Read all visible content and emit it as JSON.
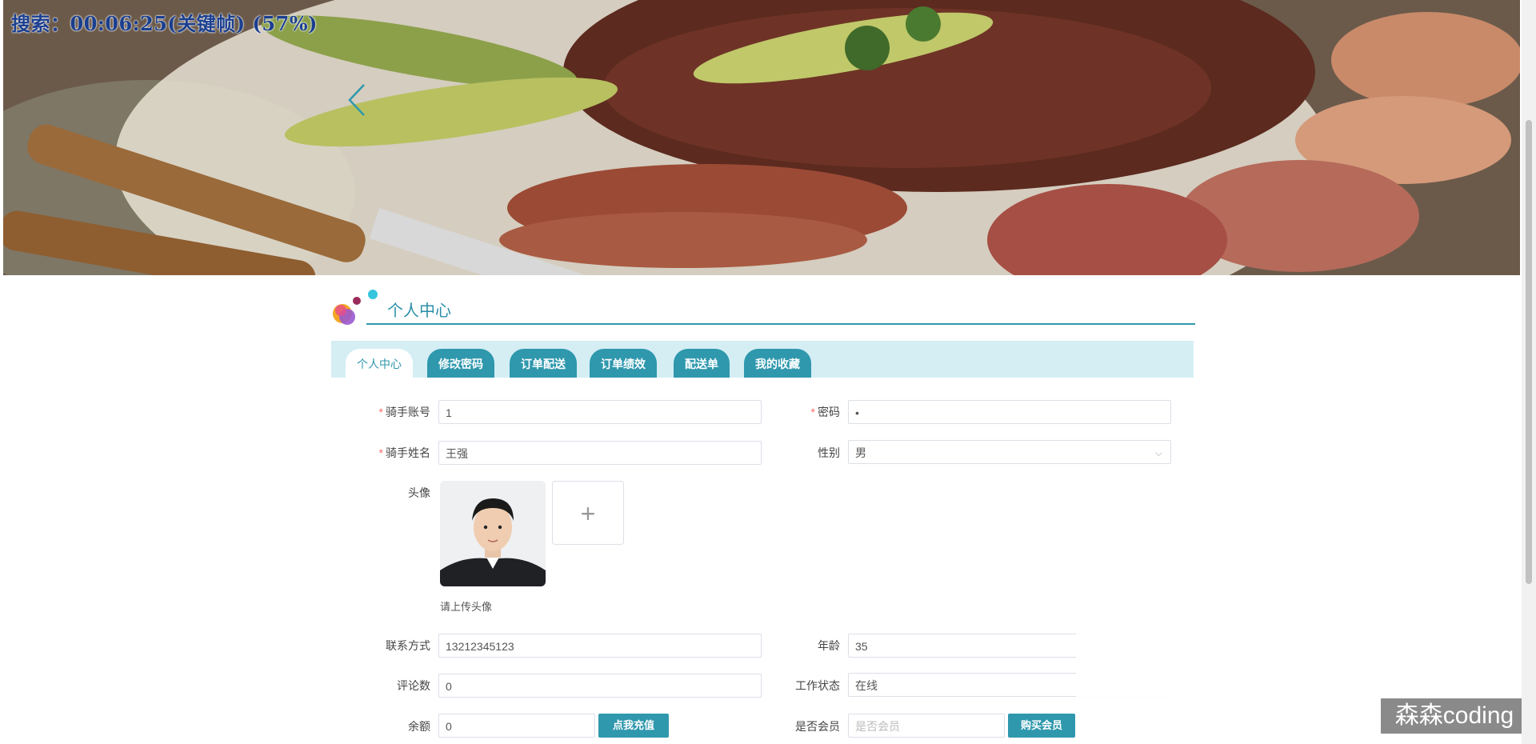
{
  "overlay": {
    "search_status": "搜索：00:06:25(关键帧) (57%)"
  },
  "header": {
    "title": "个人中心"
  },
  "tabs": [
    {
      "label": "个人中心",
      "active": true
    },
    {
      "label": "修改密码",
      "active": false
    },
    {
      "label": "订单配送",
      "active": false
    },
    {
      "label": "订单绩效",
      "active": false
    },
    {
      "label": "配送单",
      "active": false
    },
    {
      "label": "我的收藏",
      "active": false
    }
  ],
  "form": {
    "rider_account": {
      "label": "骑手账号",
      "value": "1",
      "required": true
    },
    "password": {
      "label": "密码",
      "value": "•",
      "required": true
    },
    "rider_name": {
      "label": "骑手姓名",
      "value": "王强",
      "required": true
    },
    "gender": {
      "label": "性别",
      "value": "男"
    },
    "avatar": {
      "label": "头像",
      "hint": "请上传头像"
    },
    "contact": {
      "label": "联系方式",
      "value": "13212345123"
    },
    "age": {
      "label": "年龄",
      "value": "35"
    },
    "reviews": {
      "label": "评论数",
      "value": "0"
    },
    "work_status": {
      "label": "工作状态",
      "value": "在线"
    },
    "balance": {
      "label": "余额",
      "value": "0",
      "button": "点我充值"
    },
    "member": {
      "label": "是否会员",
      "placeholder": "是否会员",
      "button": "购买会员"
    }
  },
  "watermark": "森森coding",
  "colors": {
    "accent": "#2f98ad",
    "tabbar_bg": "#d4eef4",
    "required": "#f56c6c"
  },
  "icons": {
    "carousel_prev": "chevron-left-icon",
    "upload": "plus-icon",
    "select": "chevron-down-icon"
  }
}
